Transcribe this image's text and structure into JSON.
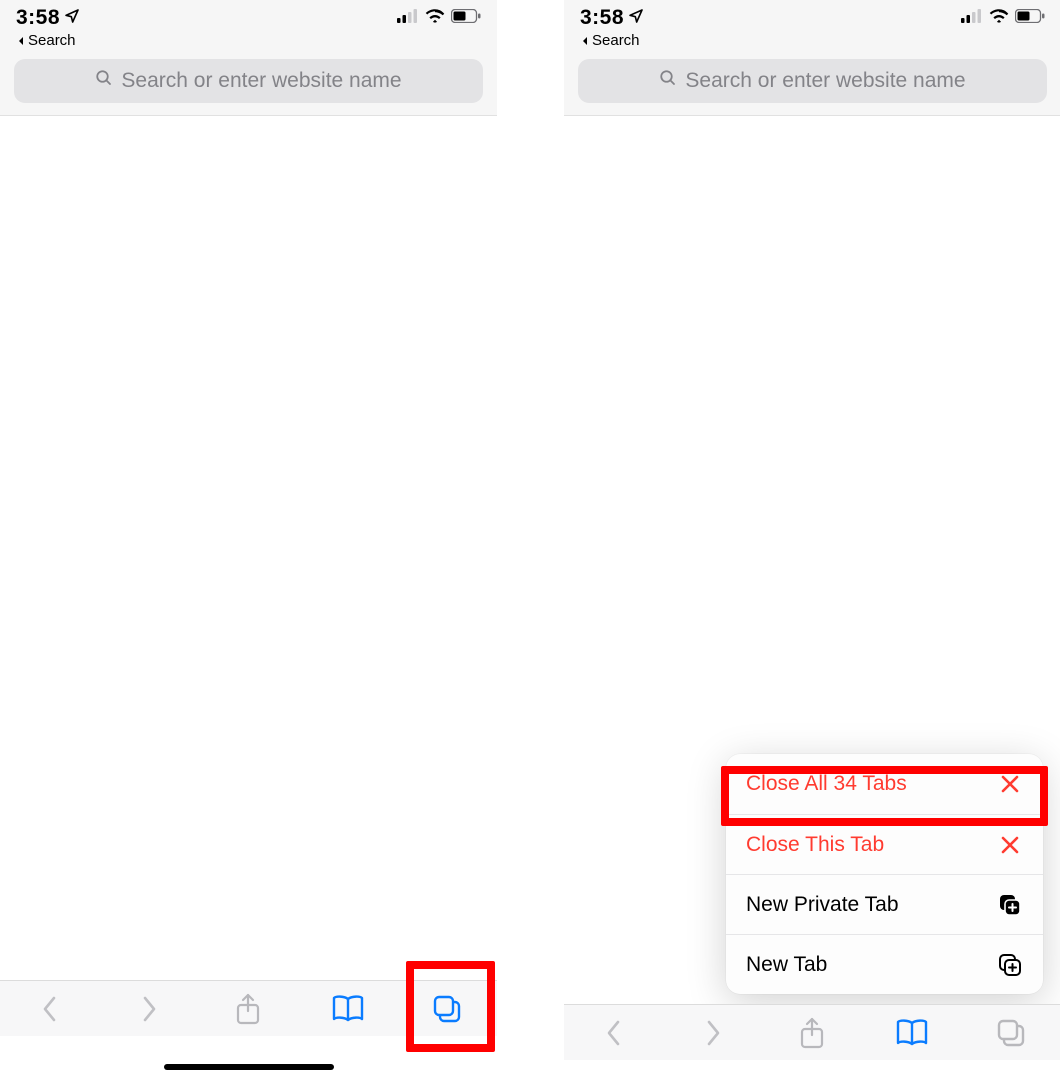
{
  "status": {
    "time": "3:58",
    "breadcrumb_label": "Search"
  },
  "search": {
    "placeholder": "Search or enter website name"
  },
  "menu": {
    "close_all_label": "Close All 34 Tabs",
    "close_this_label": "Close This Tab",
    "new_private_label": "New Private Tab",
    "new_tab_label": "New Tab"
  },
  "icons": {
    "location": "location-arrow-icon",
    "signal": "cell-signal-icon",
    "wifi": "wifi-icon",
    "battery": "battery-icon",
    "search": "search-icon",
    "back": "chevron-left-icon",
    "forward": "chevron-right-icon",
    "share": "share-icon",
    "bookmarks": "book-icon",
    "tabs": "tabs-icon",
    "close": "close-icon",
    "newtab_private": "plus-on-square-filled-icon",
    "newtab": "plus-on-square-icon"
  },
  "colors": {
    "blue": "#0a7cff",
    "red": "#ff3b30",
    "chrome_grey": "#b8b8bc",
    "field_grey": "#e3e3e5"
  }
}
